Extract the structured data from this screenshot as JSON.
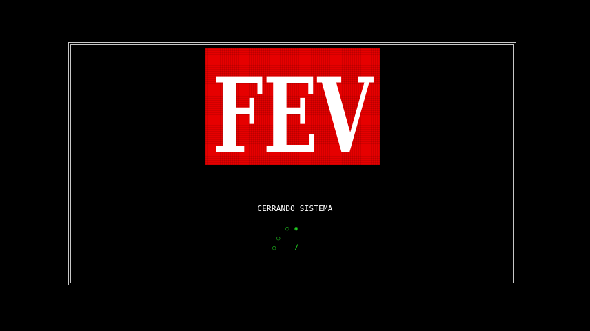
{
  "logo": {
    "text": "FEV",
    "background_color": "#e60000",
    "text_color": "#ffffff"
  },
  "status": {
    "message": "CERRANDO SISTEMA"
  },
  "spinner": {
    "color": "#22cc22",
    "glyph_hollow": "○",
    "glyph_filled": "◉",
    "glyph_slash": "/"
  },
  "frame": {
    "color": "#c8c8c8"
  }
}
